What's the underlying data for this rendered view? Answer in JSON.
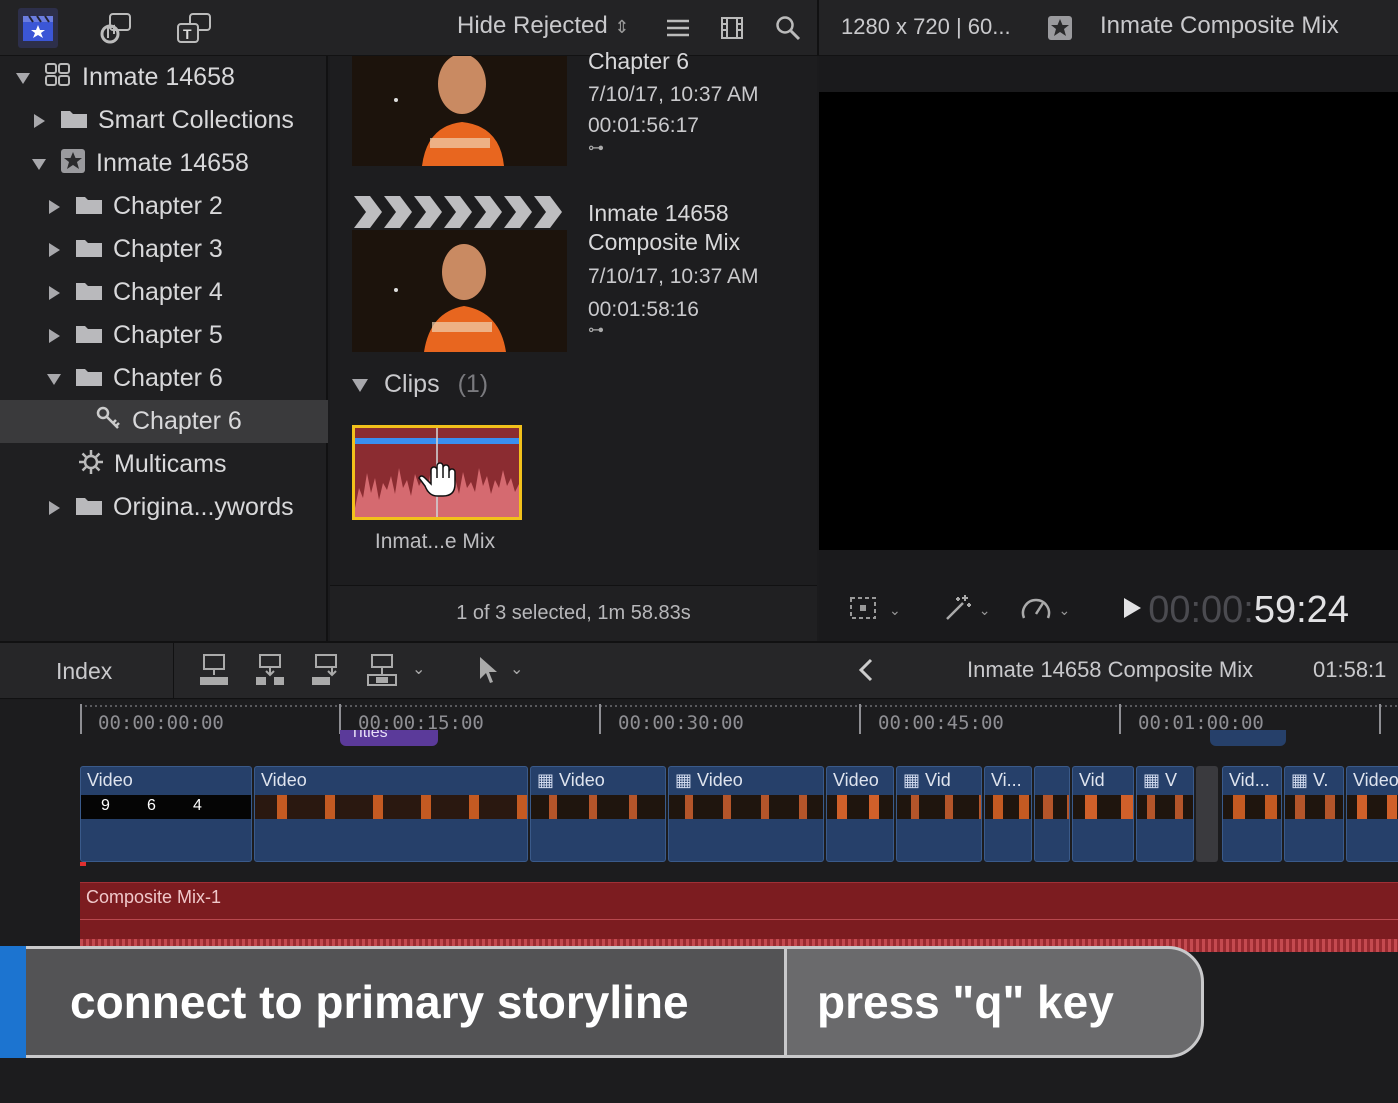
{
  "toolbar": {
    "filter_label": "Hide Rejected",
    "resolution": "1280 x 720 | 60...",
    "viewer_title": "Inmate Composite Mix",
    "icons": [
      "libraries-icon",
      "photos-audio-icon",
      "titles-generators-icon",
      "list-view-icon",
      "filmstrip-icon",
      "search-icon",
      "star-icon"
    ]
  },
  "sidebar": {
    "items": [
      {
        "label": "Inmate 14658",
        "icon": "library-icon",
        "disclosure": "open"
      },
      {
        "label": "Smart Collections",
        "icon": "folder-icon",
        "disclosure": "closed"
      },
      {
        "label": "Inmate 14658",
        "icon": "event-star-icon",
        "disclosure": "open"
      },
      {
        "label": "Chapter 2",
        "icon": "folder-icon",
        "disclosure": "closed"
      },
      {
        "label": "Chapter 3",
        "icon": "folder-icon",
        "disclosure": "closed"
      },
      {
        "label": "Chapter 4",
        "icon": "folder-icon",
        "disclosure": "closed"
      },
      {
        "label": "Chapter 5",
        "icon": "folder-icon",
        "disclosure": "closed"
      },
      {
        "label": "Chapter 6",
        "icon": "folder-icon",
        "disclosure": "open"
      },
      {
        "label": "Chapter 6",
        "icon": "keyword-icon",
        "disclosure": "none",
        "selected": true
      },
      {
        "label": "Multicams",
        "icon": "gear-icon",
        "disclosure": "none"
      },
      {
        "label": "Origina...ywords",
        "icon": "folder-icon",
        "disclosure": "closed"
      }
    ]
  },
  "browser": {
    "items": [
      {
        "title": "Chapter 6",
        "date": "7/10/17, 10:37 AM",
        "duration": "00:01:56:17"
      },
      {
        "title_line1": "Inmate 14658",
        "title_line2": "Composite Mix",
        "date": "7/10/17, 10:37 AM",
        "duration": "00:01:58:16"
      }
    ],
    "clips_heading": "Clips",
    "clips_count": "(1)",
    "clip_name": "Inmat...e Mix",
    "status": "1 of 3 selected, 1m 58.83s"
  },
  "viewer": {
    "timecode_dim": "00:00:",
    "timecode_bright": "59:24"
  },
  "timeline_bar": {
    "index_label": "Index",
    "project_title": "Inmate 14658 Composite Mix",
    "duration": "01:58:1"
  },
  "timeline": {
    "ruler": [
      "00:00:00:00",
      "00:00:15:00",
      "00:00:30:00",
      "00:00:45:00",
      "00:01:00:00"
    ],
    "titles_label": "Titles",
    "clips": [
      "Video",
      "Video",
      "Video",
      "Video",
      "Video",
      "Vid",
      "Vi...",
      "",
      "Vid",
      "V",
      "Vid...",
      "V.",
      "Video"
    ],
    "countdown": [
      "9",
      "6",
      "4"
    ],
    "audio_label": "Composite Mix-1"
  },
  "caption": {
    "left": "connect to primary storyline",
    "right": "press \"q\" key"
  },
  "colors": {
    "selection": "#f2c11b",
    "clip_blue": "#26406a",
    "audio_red": "#7c1c20",
    "caption_blue": "#1c74d0"
  }
}
